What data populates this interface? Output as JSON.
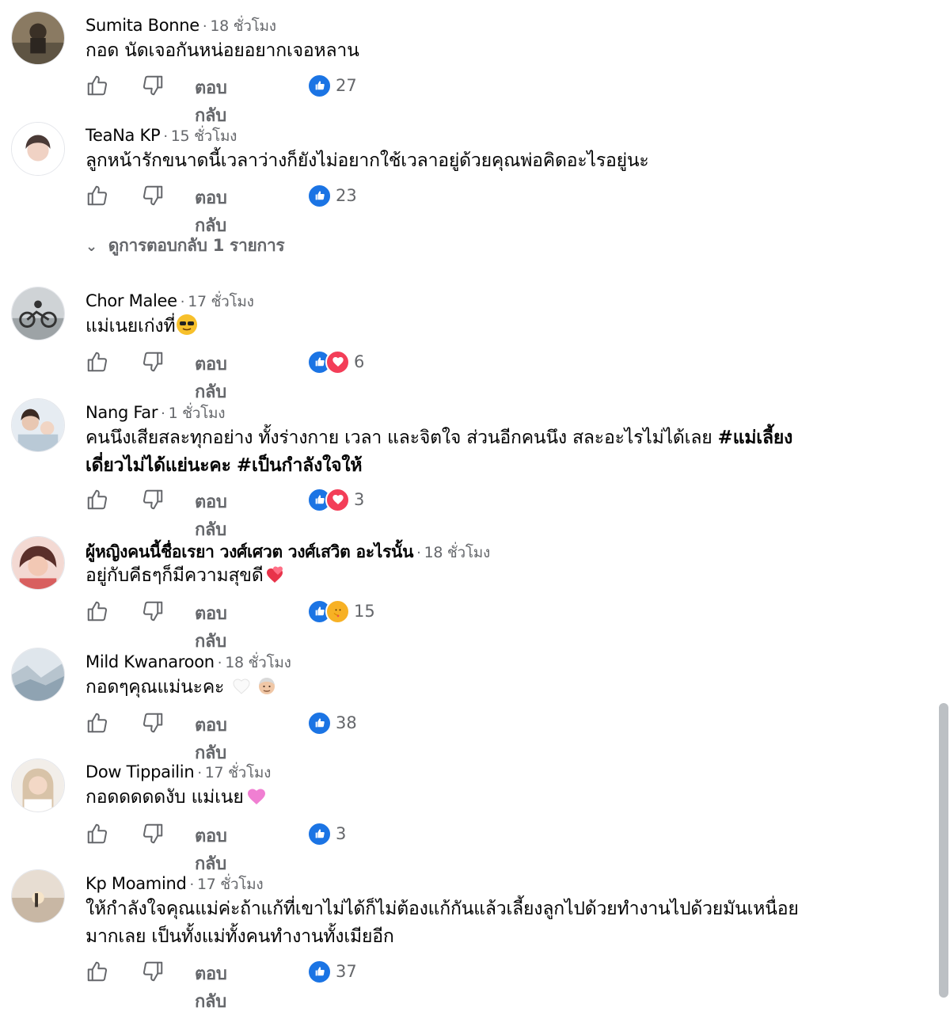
{
  "ui": {
    "reply_label": "ตอบกลับ"
  },
  "comments": [
    {
      "name": "Sumita Bonne",
      "time": "18 ชั่วโมง",
      "text": "กอด นัดเจอกันหน่อยอยากเจอหลาน",
      "reactions": [
        "like"
      ],
      "count": "27"
    },
    {
      "name": "TeaNa KP",
      "time": "15 ชั่วโมง",
      "text": "ลูกหน้ารักขนาดนี้เวลาว่างก็ยังไม่อยากใช้เวลาอยู่ด้วยคุณพ่อคิดอะไรอยู่นะ",
      "reactions": [
        "like"
      ],
      "count": "23"
    },
    {
      "name": "Chor Malee",
      "time": "17 ชั่วโมง",
      "text": "แม่เนยเก่งที่",
      "emoji": "smiling-face-with-sunglasses",
      "reactions": [
        "like",
        "love"
      ],
      "count": "6"
    },
    {
      "name": "Nang Far",
      "time": "1 ชั่วโมง",
      "text_line1": "คนนึงเสียสละทุกอย่าง ทั้งร่างกาย เวลา และจิตใจ ส่วนอีกคนนึง สละอะไรไม่ได้เลย ",
      "tag1_line1": "#แม่เลี้ยง",
      "tag1_line2": "เดี่ยวไม่ได้แย่นะคะ",
      "tag2": "#เป็นกำลังใจให้",
      "reactions": [
        "like",
        "love"
      ],
      "count": "3"
    },
    {
      "name": "ผู้หญิงคนนี้ชื่อเรยา วงศ์เศวต วงศ์เสวิต อะไรนั้น",
      "time": "18 ชั่วโมง",
      "text": "อยู่กับคีธๆก็มีความสุขดี",
      "emoji": "heart-on-fire",
      "reactions": [
        "like",
        "care"
      ],
      "count": "15"
    },
    {
      "name": "Mild Kwanaroon",
      "time": "18 ชั่วโมง",
      "text": "กอดๆคุณแม่นะคะ ",
      "emoji": "white-heart-and-old-man",
      "reactions": [
        "like"
      ],
      "count": "38"
    },
    {
      "name": "Dow Tippailin",
      "time": "17 ชั่วโมง",
      "text": "กอดดดดดงับ แม่เนย",
      "emoji": "pink-heart",
      "reactions": [
        "like"
      ],
      "count": "3"
    },
    {
      "name": "Kp Moamind",
      "time": "17 ชั่วโมง",
      "text_line1": "ให้กำลังใจคุณแม่ค่ะถ้าแก้ที่เขาไม่ได้ก็ไม่ต้องแก้กันแล้วเลี้ยงลูกไปด้วยทำงานไปด้วยมันเหนื่อย",
      "text_line2": "มากเลย เป็นทั้งแม่ทั้งคนทำงานทั้งเมียอีก",
      "reactions": [
        "like"
      ],
      "count": "37"
    }
  ],
  "view_replies": "ดูการตอบกลับ 1 รายการ",
  "colors": {
    "like": "#1b74e4",
    "love": "#f33e58",
    "muted": "#65676b"
  }
}
